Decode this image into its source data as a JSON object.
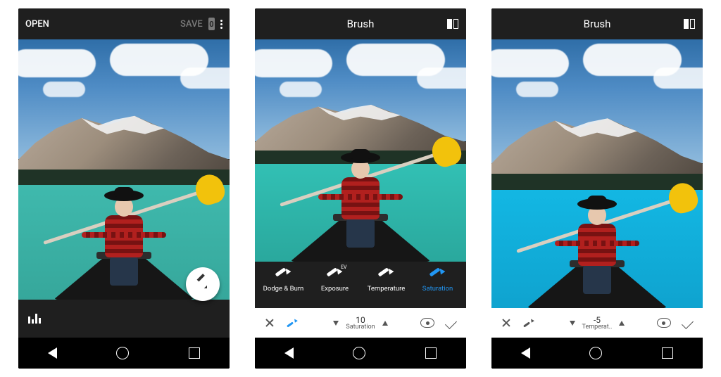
{
  "screen1": {
    "open_label": "OPEN",
    "save_label": "SAVE",
    "layer_count": "0"
  },
  "screen2": {
    "title": "Brush",
    "tools": {
      "dodge_burn": "Dodge & Burn",
      "exposure": "Exposure",
      "exposure_badge": "EV",
      "temperature": "Temperature",
      "saturation": "Saturation"
    },
    "control": {
      "value": "10",
      "label": "Saturation"
    }
  },
  "screen3": {
    "title": "Brush",
    "control": {
      "value": "-5",
      "label": "Temperat.."
    }
  }
}
